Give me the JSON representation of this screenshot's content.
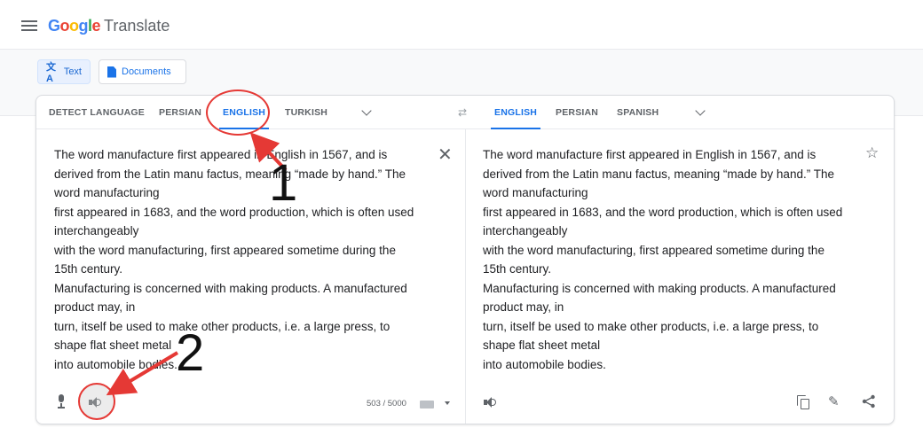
{
  "header": {
    "brand_google": "Google",
    "brand_translate": "Translate"
  },
  "modes": [
    {
      "label": "Text",
      "icon": "translate-icon",
      "active": true
    },
    {
      "label": "Documents",
      "icon": "document-icon",
      "active": false
    }
  ],
  "source_langs": [
    "DETECT LANGUAGE",
    "PERSIAN",
    "ENGLISH",
    "TURKISH"
  ],
  "source_active": "ENGLISH",
  "target_langs": [
    "ENGLISH",
    "PERSIAN",
    "SPANISH"
  ],
  "target_active": "ENGLISH",
  "source_text": "The word manufacture first appeared in English in 1567, and is\nderived from the Latin manu factus, meaning “made by hand.” The\nword manufacturing\nfirst appeared in 1683, and the word production, which is often used\ninterchangeably\nwith the word manufacturing, first appeared sometime during the\n15th century.\nManufacturing is concerned with making products. A manufactured\nproduct may, in\nturn, itself be used to make other products, i.e. a large press, to\nshape flat sheet metal\ninto automobile bodies.",
  "target_text": "The word manufacture first appeared in English in 1567, and is\nderived from the Latin manu factus, meaning “made by hand.” The\nword manufacturing\nfirst appeared in 1683, and the word production, which is often used\ninterchangeably\nwith the word manufacturing, first appeared sometime during the\n15th century.\nManufacturing is concerned with making products. A manufactured\nproduct may, in\nturn, itself be used to make other products, i.e. a large press, to\nshape flat sheet metal\ninto automobile bodies.",
  "char_counter": "503 / 5000",
  "annotations": {
    "one": "1",
    "two": "2",
    "color": "#e53935"
  },
  "colors": {
    "accent": "#1a73e8",
    "annotation": "#e53935"
  }
}
